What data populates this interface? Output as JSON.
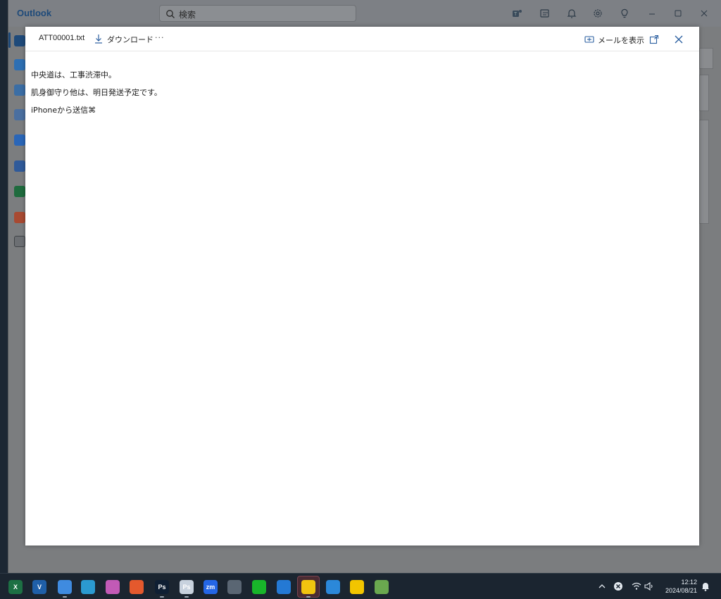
{
  "app": {
    "name": "Outlook"
  },
  "search": {
    "placeholder": "検索"
  },
  "viewer": {
    "file_name": "ATT00001.txt",
    "download_label": "ダウンロード",
    "more_label": "···",
    "show_mail_label": "メールを表示",
    "content_lines": [
      "中央道は、工事渋滞中。",
      "肌身御守り他は、明日発送予定です。",
      "iPhoneから送信⌘"
    ]
  },
  "taskbar": {
    "apps": [
      {
        "name": "excel-icon",
        "glyph": "X",
        "color": "#1d7044"
      },
      {
        "name": "vscode-icon",
        "glyph": "V",
        "color": "#1f5fa8"
      },
      {
        "name": "chrome-icon",
        "glyph": "",
        "color": "#3f8be0"
      },
      {
        "name": "edge-icon",
        "glyph": "",
        "color": "#2b9ad0"
      },
      {
        "name": "photos-icon",
        "glyph": "",
        "color": "#c25ab6"
      },
      {
        "name": "firefox-icon",
        "glyph": "",
        "color": "#e4592d"
      },
      {
        "name": "photoshop-icon",
        "glyph": "Ps",
        "color": "#0f1f33"
      },
      {
        "name": "photoshop-2-icon",
        "glyph": "Ps",
        "color": "#c8d2de"
      },
      {
        "name": "zoom-icon",
        "glyph": "zm",
        "color": "#2466e6"
      },
      {
        "name": "calculator-icon",
        "glyph": "",
        "color": "#5a6673"
      },
      {
        "name": "green-app-icon",
        "glyph": "",
        "color": "#18b52a"
      },
      {
        "name": "safari-icon",
        "glyph": "",
        "color": "#2479d4"
      },
      {
        "name": "sticky-notes-icon",
        "glyph": "",
        "color": "#f1c40f"
      },
      {
        "name": "draw-icon",
        "glyph": "",
        "color": "#2b88d9"
      },
      {
        "name": "norton-icon",
        "glyph": "",
        "color": "#f2c500"
      },
      {
        "name": "network-app-icon",
        "glyph": "",
        "color": "#6aa84f"
      }
    ],
    "clock_time": "12:12",
    "clock_date": "2024/08/21"
  }
}
